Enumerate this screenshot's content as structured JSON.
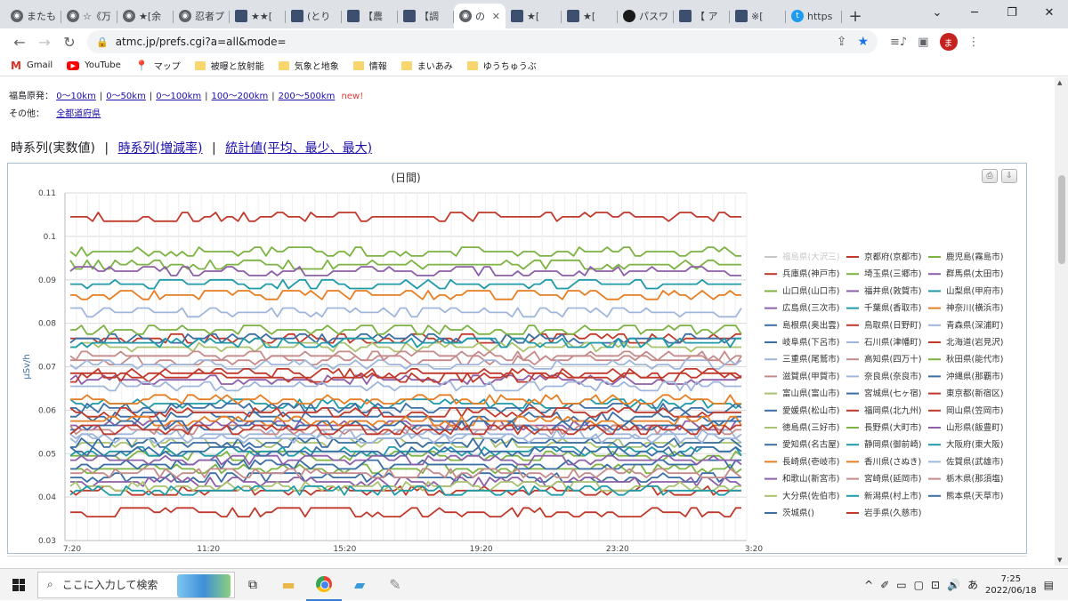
{
  "browser": {
    "tabs": [
      {
        "label": "またも",
        "icon": "globe-icon"
      },
      {
        "label": "☆《万",
        "icon": "globe-icon"
      },
      {
        "label": "★[余",
        "icon": "globe-icon"
      },
      {
        "label": "忍者プ",
        "icon": "globe-icon"
      },
      {
        "label": "★★[",
        "icon": "site-icon"
      },
      {
        "label": "(とり",
        "icon": "site-icon"
      },
      {
        "label": "【農",
        "icon": "site-icon"
      },
      {
        "label": "【調",
        "icon": "site-icon"
      },
      {
        "label": "の",
        "icon": "globe-icon",
        "active": true
      },
      {
        "label": "★[",
        "icon": "site-icon"
      },
      {
        "label": "★[",
        "icon": "site-icon"
      },
      {
        "label": "パスワ",
        "icon": "black-logo-icon"
      },
      {
        "label": "【 ア",
        "icon": "site-icon"
      },
      {
        "label": "※[",
        "icon": "site-icon"
      },
      {
        "label": "https",
        "icon": "twitter-icon"
      }
    ],
    "new_tab_symbol": "+",
    "url": "atmc.jp/prefs.cgi?a=all&mode=",
    "avatar_letter": "ま",
    "bookmarks": [
      {
        "label": "Gmail",
        "icon": "gmail-icon"
      },
      {
        "label": "YouTube",
        "icon": "youtube-icon"
      },
      {
        "label": "マップ",
        "icon": "maps-icon"
      },
      {
        "label": "被曝と放射能",
        "icon": "folder-icon"
      },
      {
        "label": "気象と地象",
        "icon": "folder-icon"
      },
      {
        "label": "情報",
        "icon": "folder-icon"
      },
      {
        "label": "まいあみ",
        "icon": "folder-icon"
      },
      {
        "label": "ゆうちゅうぶ",
        "icon": "folder-icon"
      }
    ]
  },
  "page": {
    "fukushima_label": "福島原発：",
    "fukushima_links": [
      "0～10km",
      "0～50km",
      "0～100km",
      "100～200km",
      "200～500km"
    ],
    "new_label": "new!",
    "other_label": "その他：",
    "other_links": [
      "全都道府県"
    ],
    "modes": {
      "current": "時系列(実数値)",
      "links": [
        "時系列(増減率)",
        "統計値(平均、最少、最大)"
      ]
    }
  },
  "chart_data": {
    "type": "line",
    "title": "(日間)",
    "ylabel": "μSv/h",
    "ylim": [
      0.03,
      0.11
    ],
    "yticks": [
      "0.03",
      "0.04",
      "0.05",
      "0.06",
      "0.07",
      "0.08",
      "0.09",
      "0.1",
      "0.11"
    ],
    "xticks": [
      "7:20",
      "11:20",
      "15:20",
      "19:20",
      "23:20",
      "3:20"
    ],
    "n_points": 120,
    "grid": true,
    "legend_position": "right",
    "series": [
      {
        "name": "福島県(大沢三)",
        "color": "#c8c8c8",
        "base": null,
        "hidden": true
      },
      {
        "name": "京都府(京都市)",
        "color": "#c0392b",
        "base": 0.0415
      },
      {
        "name": "鹿児島(霧島市)",
        "color": "#7cb342",
        "base": 0.0965
      },
      {
        "name": "兵庫県(神戸市)",
        "color": "#c0392b",
        "base": 0.1045
      },
      {
        "name": "埼玉県(三郷市)",
        "color": "#7cb342",
        "base": 0.0935
      },
      {
        "name": "群馬県(太田市)",
        "color": "#8e5fa8",
        "base": 0.092
      },
      {
        "name": "山口県(山口市)",
        "color": "#7cb342",
        "base": 0.0465
      },
      {
        "name": "福井県(敦賀市)",
        "color": "#8e5fa8",
        "base": 0.0565
      },
      {
        "name": "山梨県(甲府市)",
        "color": "#1f9aa8",
        "base": 0.089
      },
      {
        "name": "広島県(三次市)",
        "color": "#8e5fa8",
        "base": 0.067
      },
      {
        "name": "千葉県(香取市)",
        "color": "#1f9aa8",
        "base": 0.0615
      },
      {
        "name": "神奈川(横浜市)",
        "color": "#e67e22",
        "base": 0.0865
      },
      {
        "name": "島根県(奥出雲)",
        "color": "#3a6ea5",
        "base": 0.0585
      },
      {
        "name": "鳥取県(日野町)",
        "color": "#c0392b",
        "base": 0.0765
      },
      {
        "name": "青森県(深浦町)",
        "color": "#9fb6dc",
        "base": 0.0825
      },
      {
        "name": "岐阜県(下呂市)",
        "color": "#3a6ea5",
        "base": 0.0765
      },
      {
        "name": "石川県(津幡町)",
        "color": "#9fb6dc",
        "base": 0.0545
      },
      {
        "name": "北海道(岩見沢)",
        "color": "#c0392b",
        "base": 0.0675
      },
      {
        "name": "三重県(尾鷲市)",
        "color": "#9fb6dc",
        "base": 0.0655
      },
      {
        "name": "高知県(四万十)",
        "color": "#c58a8a",
        "base": 0.0555
      },
      {
        "name": "秋田県(能代市)",
        "color": "#7cb342",
        "base": 0.0495
      },
      {
        "name": "滋賀県(甲賀市)",
        "color": "#c58a8a",
        "base": 0.0715
      },
      {
        "name": "奈良県(奈良市)",
        "color": "#9fb6dc",
        "base": 0.0705
      },
      {
        "name": "沖縄県(那覇市)",
        "color": "#3a6ea5",
        "base": 0.0445
      },
      {
        "name": "富山県(富山市)",
        "color": "#a9c26f",
        "base": 0.0745
      },
      {
        "name": "宮城県(七ヶ宿)",
        "color": "#3a6ea5",
        "base": 0.0475
      },
      {
        "name": "東京都(新宿区)",
        "color": "#c0392b",
        "base": 0.0365
      },
      {
        "name": "愛媛県(松山市)",
        "color": "#3a6ea5",
        "base": 0.0605
      },
      {
        "name": "福岡県(北九州)",
        "color": "#c0392b",
        "base": 0.0595
      },
      {
        "name": "岡山県(笠岡市)",
        "color": "#c0392b",
        "base": 0.0685
      },
      {
        "name": "徳島県(三好市)",
        "color": "#a9c26f",
        "base": 0.0525
      },
      {
        "name": "長野県(大町市)",
        "color": "#7cb342",
        "base": 0.0785
      },
      {
        "name": "山形県(飯豊町)",
        "color": "#8e5fa8",
        "base": 0.0435
      },
      {
        "name": "愛知県(名古屋)",
        "color": "#3a6ea5",
        "base": 0.0525
      },
      {
        "name": "静岡県(御前崎)",
        "color": "#1f9aa8",
        "base": 0.0755
      },
      {
        "name": "大阪府(東大阪)",
        "color": "#1f9aa8",
        "base": 0.0505
      },
      {
        "name": "長崎県(壱岐市)",
        "color": "#e67e22",
        "base": 0.0575
      },
      {
        "name": "香川県(さぬき)",
        "color": "#e67e22",
        "base": 0.0625
      },
      {
        "name": "佐賀県(武雄市)",
        "color": "#9fb6dc",
        "base": 0.0535
      },
      {
        "name": "和歌山(新宮市)",
        "color": "#8e5fa8",
        "base": 0.0485
      },
      {
        "name": "宮崎県(延岡市)",
        "color": "#c58a8a",
        "base": 0.0455
      },
      {
        "name": "栃木県(那須塩)",
        "color": "#c58a8a",
        "base": 0.0725
      },
      {
        "name": "大分県(佐伯市)",
        "color": "#a9c26f",
        "base": 0.0425
      },
      {
        "name": "新潟県(村上市)",
        "color": "#1f9aa8",
        "base": 0.0415
      },
      {
        "name": "熊本県(天草市)",
        "color": "#3a6ea5",
        "base": 0.0505
      },
      {
        "name": "茨城県()",
        "color": "#3a6ea5",
        "base": 0.0565
      },
      {
        "name": "岩手県(久慈市)",
        "color": "#c0392b",
        "base": 0.0555
      }
    ]
  },
  "taskbar": {
    "search_placeholder": "ここに入力して検索",
    "ime": "あ",
    "time": "7:25",
    "date": "2022/06/18"
  }
}
